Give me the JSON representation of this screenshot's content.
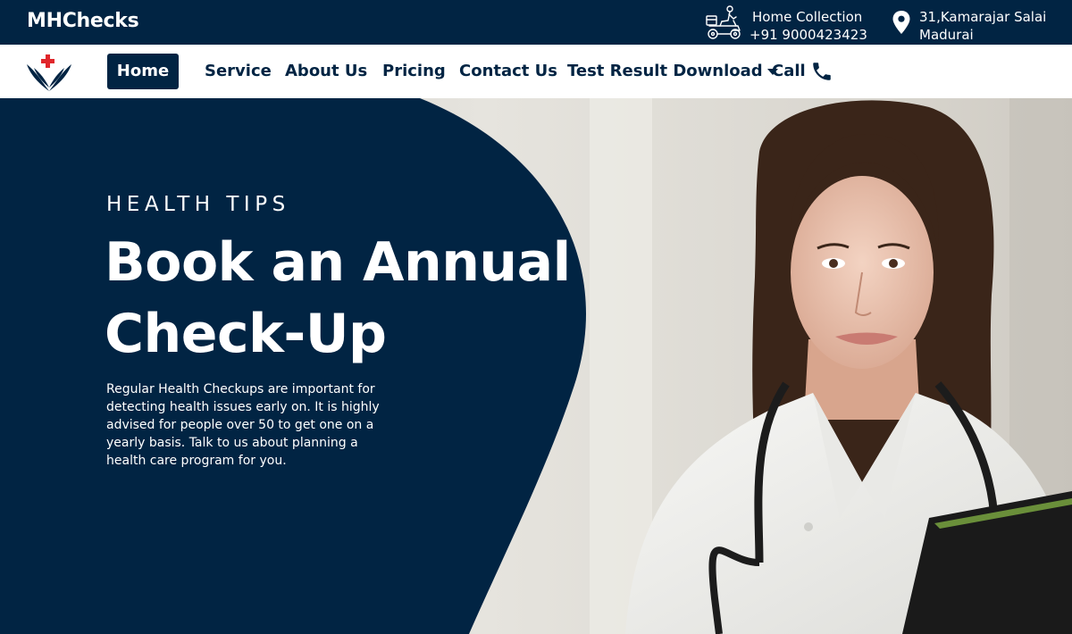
{
  "topbar": {
    "brand": "MHChecks",
    "home_collection": {
      "label": "Home Collection",
      "phone": "+91  9000423423"
    },
    "address": {
      "line1": "31,Kamarajar Salai",
      "line2": "Madurai"
    }
  },
  "nav": {
    "items": [
      {
        "label": "Home",
        "active": true
      },
      {
        "label": "Service"
      },
      {
        "label": "About Us"
      },
      {
        "label": "Pricing"
      },
      {
        "label": "Contact Us"
      },
      {
        "label": "Test Result Download"
      },
      {
        "label": "Call"
      }
    ]
  },
  "hero": {
    "eyebrow": "HEALTH TIPS",
    "headline": "Book an Annual Check-Up",
    "description": "Regular Health Checkups are important for detecting health issues early on. It is highly advised for people over 50 to get one on a yearly basis. Talk to us about planning a health care program for you."
  },
  "colors": {
    "navy": "#012443",
    "white": "#ffffff",
    "logo_red": "#e0262b"
  },
  "icons": {
    "delivery": "delivery-scooter-icon",
    "location": "map-pin-icon",
    "phone": "phone-icon",
    "caret": "caret-down-icon"
  }
}
